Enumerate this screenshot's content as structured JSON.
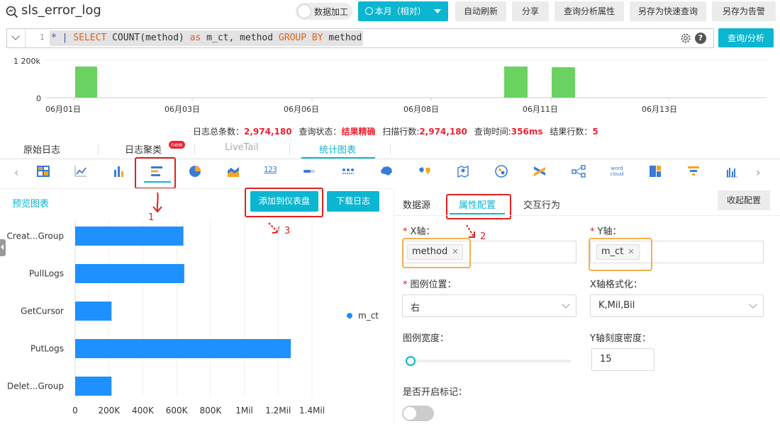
{
  "header": {
    "title": "sls_error_log",
    "toggle_label": "数据加工",
    "time_range": "本月（相对）",
    "buttons": [
      "自动刷新",
      "分享",
      "查询分析属性",
      "另存为快速查询",
      "另存为告警"
    ]
  },
  "query": {
    "line_no": "1",
    "parts": [
      "*",
      " | ",
      "SELECT",
      " COUNT(method) ",
      "as",
      " m_ct, method ",
      "GROUP BY",
      " method"
    ],
    "submit_label": "查询/分析"
  },
  "histogram": {
    "y_ticks": [
      "1 200k",
      "0"
    ],
    "x_ticks": [
      "06月01日",
      "06月03日",
      "06月06日",
      "06月08日",
      "06月11日",
      "06月13日"
    ]
  },
  "stats": {
    "total_label": "日志总条数：",
    "total": "2,974,180",
    "status_label": "查询状态：",
    "status": "结果精确",
    "scan_label": "扫描行数:",
    "scan": "2,974,180",
    "time_label": "查询时间:",
    "time": "356ms",
    "rows_label": "结果行数：",
    "rows": "5"
  },
  "tabs": {
    "raw": "原始日志",
    "cluster": "日志聚类",
    "cluster_badge": "new",
    "livetail": "LiveTail",
    "chart": "统计图表"
  },
  "preview": {
    "title": "预览图表",
    "add_dashboard": "添加到仪表盘",
    "download": "下载日志"
  },
  "chart_data": {
    "type": "bar",
    "orientation": "horizontal",
    "categories": [
      "Creat...Group",
      "PullLogs",
      "GetCursor",
      "PutLogs",
      "Delet...Group"
    ],
    "series": [
      {
        "name": "m_ct",
        "values": [
          640000,
          645000,
          215000,
          1275000,
          215000
        ]
      }
    ],
    "x_ticks": [
      "0",
      "200K",
      "400K",
      "600K",
      "800K",
      "1Mil",
      "1.2Mil",
      "1.4Mil"
    ],
    "xlim": [
      0,
      1400000
    ],
    "legend": "right",
    "color": "#1e90ff"
  },
  "config": {
    "tabs": [
      "数据源",
      "属性配置",
      "交互行为"
    ],
    "collapse": "收起配置",
    "x_axis_label": "X轴：",
    "x_axis_value": "method",
    "y_axis_label": "Y轴：",
    "y_axis_value": "m_ct",
    "legend_pos_label": "图例位置：",
    "legend_pos_value": "右",
    "x_format_label": "X轴格式化：",
    "x_format_value": "K,Mil,Bil",
    "legend_width_label": "图例宽度：",
    "y_density_label": "Y轴刻度密度：",
    "y_density_value": "15",
    "marker_label": "是否开启标记："
  },
  "annotations": [
    "1",
    "2",
    "3"
  ],
  "colors": {
    "accent": "#0bb6d1",
    "bar": "#1e90ff",
    "hist_bar": "#6bd262",
    "annotation": "#e02020",
    "highlight": "#f0b050"
  }
}
